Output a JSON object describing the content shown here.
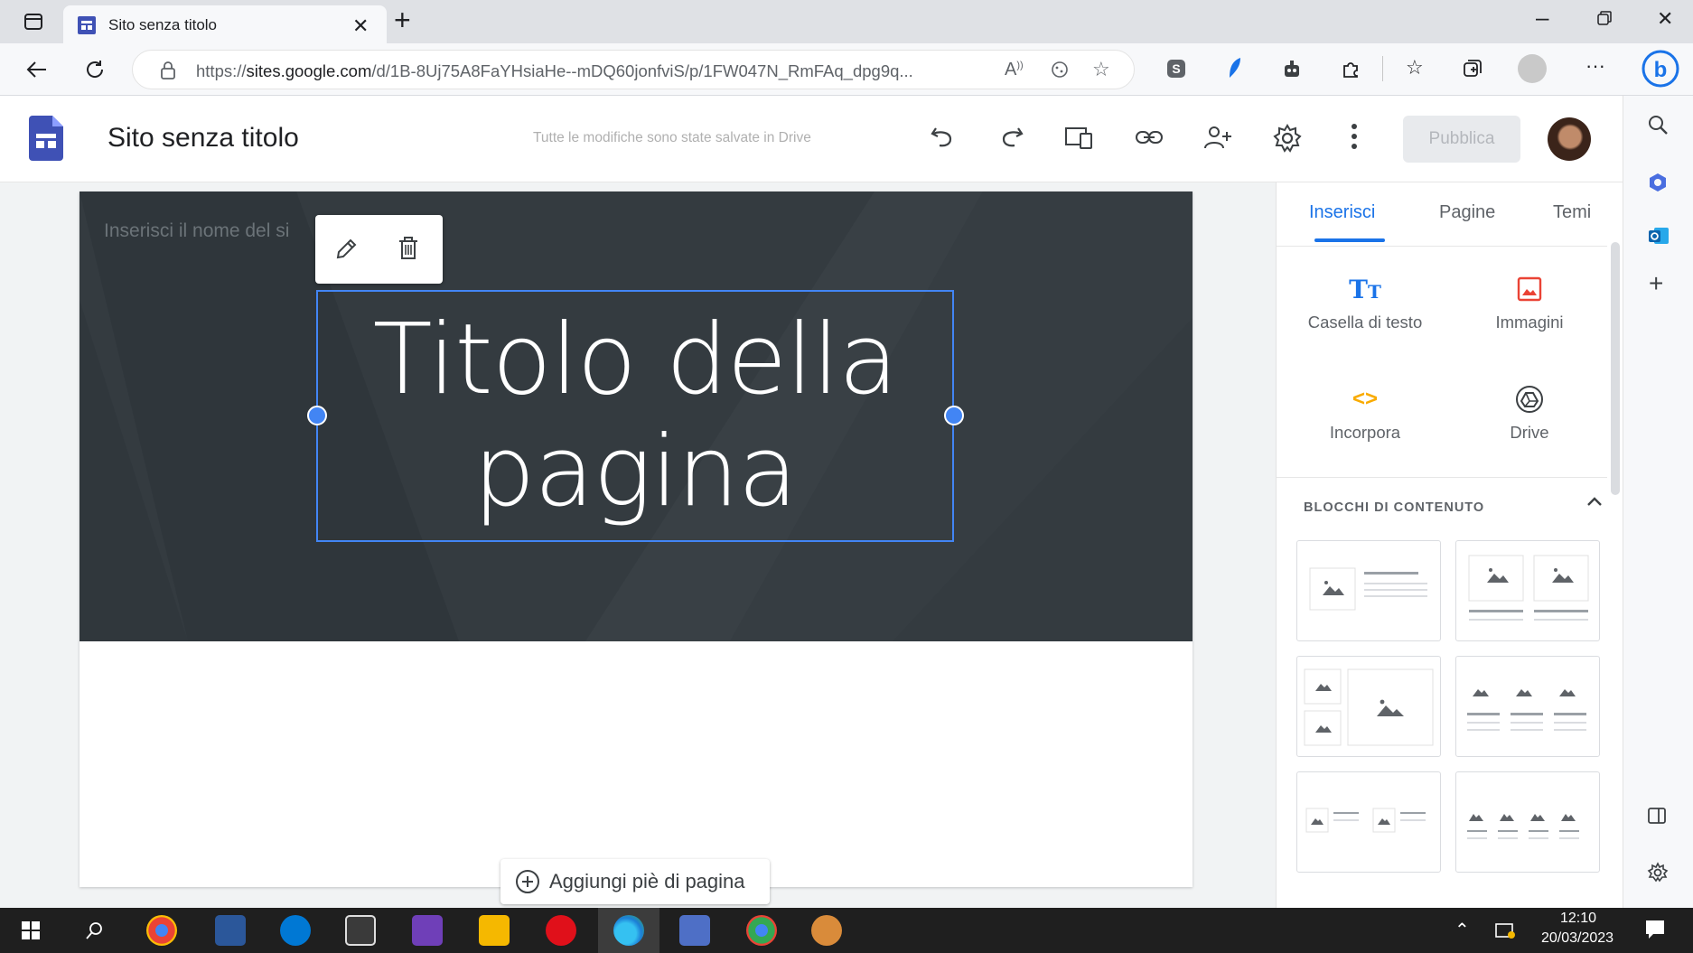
{
  "browser": {
    "tab_title": "Sito senza titolo",
    "url_prefix": "https://",
    "url_domain": "sites.google.com",
    "url_rest": "/d/1B-8Uj75A8FaYHsiaHe--mDQ60jonfviS/p/1FW047N_RmFAq_dpg9q..."
  },
  "app": {
    "doc_title": "Sito senza titolo",
    "save_status": "Tutte le modifiche sono state salvate in Drive",
    "publish_label": "Pubblica"
  },
  "canvas": {
    "site_name_placeholder": "Inserisci il nome del si",
    "page_title_line1": "Titolo della",
    "page_title_line2": "pagina",
    "add_footer_label": "Aggiungi piè di pagina"
  },
  "panel": {
    "tabs": [
      "Inserisci",
      "Pagine",
      "Temi"
    ],
    "insert_items": [
      "Casella di testo",
      "Immagini",
      "Incorpora",
      "Drive"
    ],
    "blocks_label": "BLOCCHI DI CONTENUTO"
  },
  "taskbar": {
    "time": "12:10",
    "date": "20/03/2023"
  },
  "colors": {
    "accent": "#1a73e8",
    "selection": "#4285f4",
    "header_bg": "#343b40",
    "sites_brand": "#3f51b5"
  }
}
